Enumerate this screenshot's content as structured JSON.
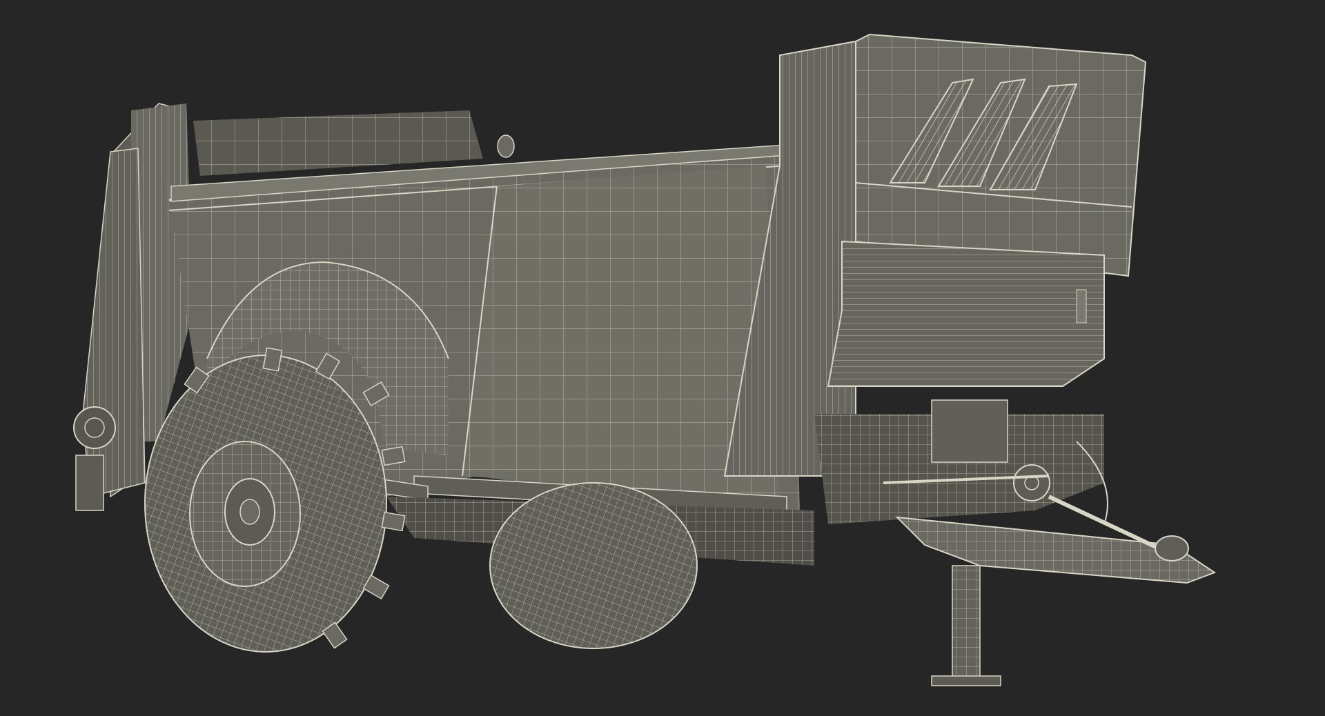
{
  "scene": {
    "subject": "manure-spreader-wireframe",
    "colors": {
      "background": "#262626",
      "body_fill": "#6b6a62",
      "body_fill_dark": "#55544d",
      "body_fill_light": "#7a796f",
      "wire": "#d8d6c6",
      "tire_fill": "#5f5e57"
    }
  }
}
